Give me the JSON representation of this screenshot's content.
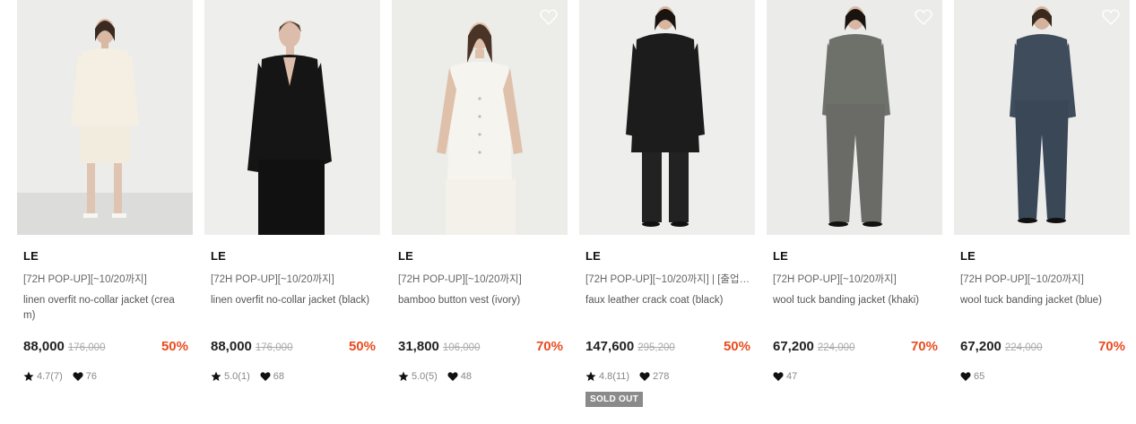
{
  "colors": {
    "accent": "#ea4c1f",
    "sold_badge": "#8a8a8a"
  },
  "products": [
    {
      "brand": "LE",
      "promo": "[72H POP-UP][~10/20까지]",
      "name": "linen overfit no-collar jacket (cream)",
      "price": "88,000",
      "original_price": "176,000",
      "discount": "50%",
      "rating": "4.7(7)",
      "likes": "76",
      "sold_out": false,
      "garment_color": "#f4efe2"
    },
    {
      "brand": "LE",
      "promo": "[72H POP-UP][~10/20까지]",
      "name": "linen overfit no-collar jacket (black)",
      "price": "88,000",
      "original_price": "176,000",
      "discount": "50%",
      "rating": "5.0(1)",
      "likes": "68",
      "sold_out": false,
      "garment_color": "#151515"
    },
    {
      "brand": "LE",
      "promo": "[72H POP-UP][~10/20까지]",
      "name": "bamboo button vest (ivory)",
      "price": "31,800",
      "original_price": "106,000",
      "discount": "70%",
      "rating": "5.0(5)",
      "likes": "48",
      "sold_out": false,
      "garment_color": "#f6f4ee"
    },
    {
      "brand": "LE",
      "promo": "[72H POP-UP][~10/20까지] | [출업 ...",
      "name": "faux leather crack coat (black)",
      "price": "147,600",
      "original_price": "295,200",
      "discount": "50%",
      "rating": "4.8(11)",
      "likes": "278",
      "sold_out": true,
      "sold_label": "SOLD OUT",
      "garment_color": "#1c1c1c"
    },
    {
      "brand": "LE",
      "promo": "[72H POP-UP][~10/20까지]",
      "name": "wool tuck banding jacket (khaki)",
      "price": "67,200",
      "original_price": "224,000",
      "discount": "70%",
      "rating": "",
      "likes": "47",
      "sold_out": false,
      "garment_color": "#6e706a"
    },
    {
      "brand": "LE",
      "promo": "[72H POP-UP][~10/20까지]",
      "name": "wool tuck banding jacket (blue)",
      "price": "67,200",
      "original_price": "224,000",
      "discount": "70%",
      "rating": "",
      "likes": "65",
      "sold_out": false,
      "garment_color": "#3e4c5c"
    }
  ]
}
